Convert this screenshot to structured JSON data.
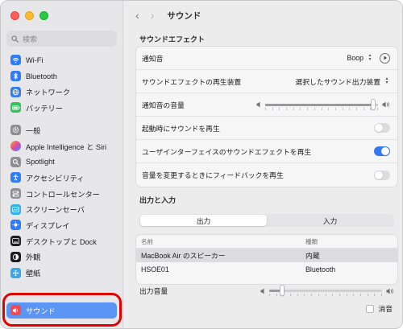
{
  "window": {
    "title": "サウンド"
  },
  "sidebar": {
    "search_placeholder": "検索",
    "items": [
      {
        "label": "Wi-Fi",
        "icon": "wifi-icon"
      },
      {
        "label": "Bluetooth",
        "icon": "bluetooth-icon"
      },
      {
        "label": "ネットワーク",
        "icon": "globe-icon"
      },
      {
        "label": "バッテリー",
        "icon": "battery-icon"
      },
      {
        "label": "一般",
        "icon": "gear-icon"
      },
      {
        "label": "Apple Intelligence と Siri",
        "icon": "apple-intelligence-icon"
      },
      {
        "label": "Spotlight",
        "icon": "spotlight-icon"
      },
      {
        "label": "アクセシビリティ",
        "icon": "accessibility-icon"
      },
      {
        "label": "コントロールセンター",
        "icon": "control-center-icon"
      },
      {
        "label": "スクリーンセーバ",
        "icon": "screensaver-icon"
      },
      {
        "label": "ディスプレイ",
        "icon": "display-icon"
      },
      {
        "label": "デスクトップと Dock",
        "icon": "desktop-dock-icon"
      },
      {
        "label": "外観",
        "icon": "appearance-icon"
      },
      {
        "label": "壁紙",
        "icon": "wallpaper-icon"
      }
    ],
    "active_item": {
      "label": "サウンド",
      "icon": "speaker-icon"
    }
  },
  "sound_effects": {
    "heading": "サウンドエフェクト",
    "alert_sound_label": "通知音",
    "alert_sound_value": "Boop",
    "play_device_label": "サウンドエフェクトの再生装置",
    "play_device_value": "選択したサウンド出力装置",
    "alert_volume_label": "通知音の音量",
    "alert_volume_level": 0.98,
    "startup_sound_label": "起動時にサウンドを再生",
    "startup_sound_on": false,
    "ui_sound_label": "ユーザインターフェイスのサウンドエフェクトを再生",
    "ui_sound_on": true,
    "volume_feedback_label": "音量を変更するときにフィードバックを再生",
    "volume_feedback_on": false
  },
  "output_input": {
    "heading": "出力と入力",
    "tabs": [
      "出力",
      "入力"
    ],
    "selected_tab": "出力",
    "columns": [
      "名前",
      "種類"
    ],
    "devices": [
      {
        "name": "MacBook Air のスピーカー",
        "type": "内蔵",
        "selected": true
      },
      {
        "name": "HSOE01",
        "type": "Bluetooth",
        "selected": false
      }
    ],
    "output_volume_label": "出力音量",
    "output_volume_level": 0.1,
    "mute_label": "消音"
  },
  "colors": {
    "accent": "#3478f6",
    "sidebar_selected": "#5a95f5",
    "highlight_ring": "#e00000"
  }
}
